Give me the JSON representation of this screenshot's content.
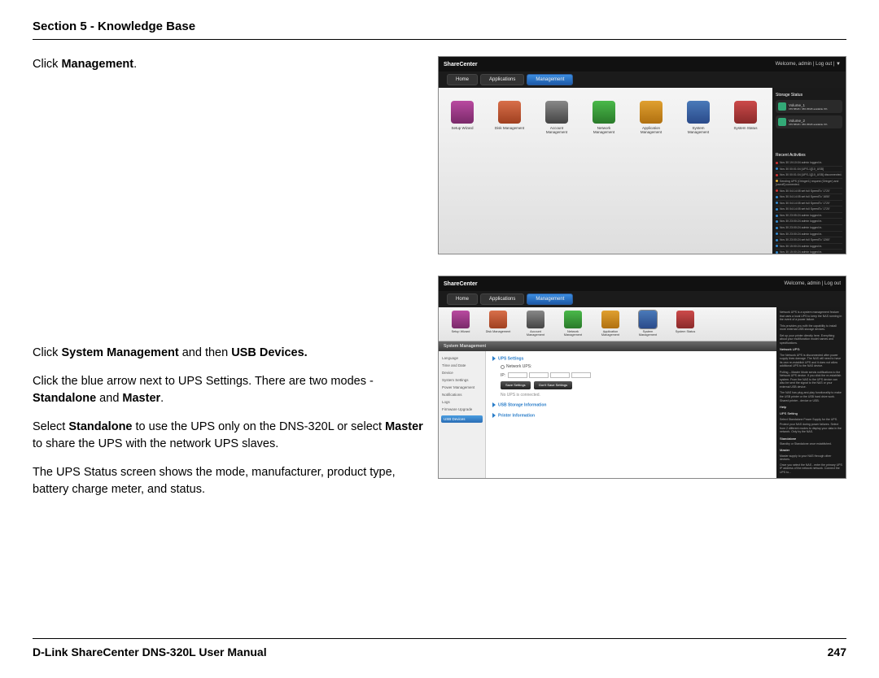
{
  "header": {
    "section": "Section 5 - Knowledge Base"
  },
  "footer": {
    "left": "D-Link ShareCenter DNS-320L User Manual",
    "page": "247"
  },
  "text": {
    "p1_a": "Click ",
    "p1_b": "Management",
    "p1_c": ".",
    "p2_a": "Click ",
    "p2_b": "System Management",
    "p2_c": " and then ",
    "p2_d": "USB Devices.",
    "p3_a": "Click the blue arrow next to UPS Settings. There are two modes - ",
    "p3_b": "Standalone",
    "p3_c": " and ",
    "p3_d": "Master",
    "p3_e": ".",
    "p4_a": "Select ",
    "p4_b": "Standalone",
    "p4_c": " to use the UPS only on the DNS-320L or select ",
    "p4_d": "Master",
    "p4_e": " to share the UPS with the network UPS slaves.",
    "p5": "The UPS Status screen shows the mode, manufacturer, product type, battery charge meter, and status."
  },
  "ss1": {
    "brand": "ShareCenter",
    "welcome": "Welcome, admin | Log out | ▼",
    "tabs": {
      "home": "Home",
      "apps": "Applications",
      "mgmt": "Management"
    },
    "icons": [
      "Setup Wizard",
      "Disk Management",
      "Account Management",
      "Network Management",
      "Application Management",
      "System Management",
      "System Status"
    ],
    "side": {
      "storage": "Storage Status",
      "vol1": "Volume_1",
      "vol1d": "155.58GB / 456.45GB available  0%",
      "vol2": "Volume_2",
      "vol2d": "155.58GB / 456.45GB available  0%",
      "recent": "Recent Activities"
    }
  },
  "ss2": {
    "brand": "ShareCenter",
    "welcome": "Welcome, admin | Log out",
    "tabs": {
      "home": "Home",
      "apps": "Applications",
      "mgmt": "Management"
    },
    "icons": [
      "Setup Wizard",
      "Disk Management",
      "Account Management",
      "Network Management",
      "Application Management",
      "System Management",
      "System Status"
    ],
    "subhead": "System Management",
    "nav": [
      "Language",
      "Time and Date",
      "Device",
      "System Settings",
      "Power Management",
      "Notifications",
      "Logs",
      "Firmware Upgrade"
    ],
    "nav_sel": "USB Devices",
    "content": {
      "ups": "UPS Settings",
      "netups": "Network UPS:",
      "ip": "IP:",
      "save": "Save Settings",
      "dont": "Don't Save Settings",
      "noups": "No UPS is connected.",
      "usbstor": "USB Storage Information",
      "printer": "Printer Information"
    },
    "side": {
      "t1": "Network UPS is a system management feature that uses a local UPS to keep the NAS running in the event of a power failure.",
      "t2": "This provides you with the capability to install more external USB storage devices.",
      "t3": "Set up your printer directly here. Everything about your multifunction model names and specifications.",
      "h1": "Network UPS:",
      "t4": "The Network UPS is disconnected after power supply lines damage. The NAS will need to have its own re-establish UPS and it does not allow additional UPS to the NAS device.",
      "t5": "Polling – Master Mode sends notifications to the Network UPS device. If you click the re-establish system. From the NAS to the UPS device can also be sent the signal to the NAS or your external USB device.",
      "t6": "The NAS has plug-and-play functionality to make the USB printer or the USB hard drive work. Shared printer - device or USB.",
      "h2": "Help",
      "h3": "UPS Setting",
      "t7": "Select Standalone Power Supply for the UPS.",
      "t8": "Protect your NAS during power failures. Select from 2 different modes to display your data in the network. Only by the NAS.",
      "h4": "Standalone",
      "t9": "Standby or Standalone once established.",
      "h5": "Master",
      "t10": "Master supply to your NAS through other devices.",
      "t11": "Once you select the NAS - enter the primary UPS IP address of the network network. Connect the UPS to..."
    }
  }
}
